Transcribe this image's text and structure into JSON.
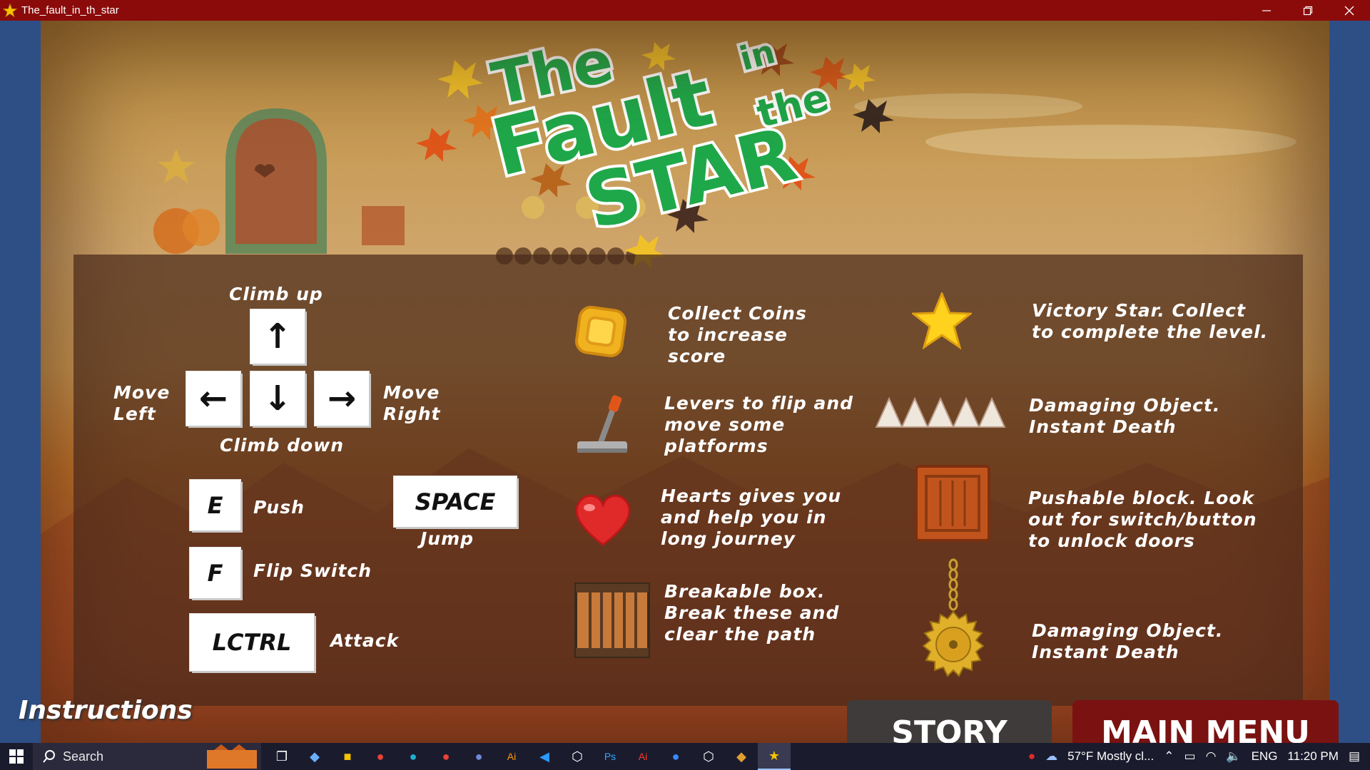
{
  "window": {
    "title": "The_fault_in_th_star",
    "minimize_icon": "minimize-icon",
    "restore_icon": "restore-icon",
    "close_icon": "close-icon"
  },
  "game_title": {
    "line1": "The",
    "line2": "Fault",
    "line3": "STAR",
    "small1": "in",
    "small2": "the"
  },
  "controls": {
    "climb_up": "Climb up",
    "climb_down": "Climb down",
    "move_left": "Move\nLeft",
    "move_right": "Move\nRight",
    "key_up": "↑",
    "key_left": "←",
    "key_down": "↓",
    "key_right": "→",
    "key_e": "E",
    "push": "Push",
    "key_space": "SPACE",
    "jump": "Jump",
    "key_f": "F",
    "flip_switch": "Flip Switch",
    "key_lctrl": "LCTRL",
    "attack": "Attack"
  },
  "items": {
    "coins": "Collect Coins\nto increase\nscore",
    "levers": "Levers to flip and\nmove some\nplatforms",
    "hearts": "Hearts gives you\nand help you in\nlong journey",
    "breakable": "Breakable box.\nBreak these and\nclear the path",
    "victory_star": "Victory Star. Collect\nto complete the level.",
    "spikes": "Damaging Object.\nInstant Death",
    "pushable": "Pushable block. Look\nout for switch/button\nto unlock doors",
    "saw": "Damaging Object.\nInstant Death"
  },
  "footer": {
    "instructions": "Instructions",
    "story": "STORY",
    "main_menu": "MAIN MENU"
  },
  "taskbar": {
    "search_placeholder": "Search",
    "weather": "57°F  Mostly cl...",
    "lang": "ENG",
    "time": "11:20 PM",
    "icons": [
      "task-view-icon",
      "app-icon",
      "file-explorer-icon",
      "chrome-icon",
      "edge-icon",
      "chrome-icon",
      "discord-icon",
      "illustrator-icon",
      "vscode-icon",
      "unity-icon",
      "photoshop-icon",
      "illustrator-icon",
      "app-icon",
      "unity-icon",
      "git-icon",
      "star-game-icon"
    ]
  },
  "colors": {
    "titlebar": "#8b0b0b",
    "title_green": "#1fa84a",
    "panel": "#4a2a1a",
    "main_menu_button": "#7a1212",
    "story_button": "#3f3b3b"
  }
}
